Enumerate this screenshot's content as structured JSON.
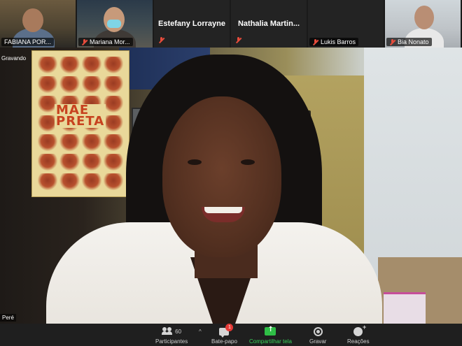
{
  "gallery": {
    "tiles": [
      {
        "name": "FABIANA POR...",
        "muted": false,
        "has_video": true
      },
      {
        "name": "Mariana Mor...",
        "muted": true,
        "has_video": true
      },
      {
        "name": "Estefany Lorrayne",
        "muted": true,
        "has_video": false
      },
      {
        "name": "Nathalia  Martin...",
        "muted": true,
        "has_video": false
      },
      {
        "name": "Lukis Barros",
        "muted": true,
        "has_video": false
      },
      {
        "name": "Bia Nonato",
        "muted": true,
        "has_video": true
      }
    ]
  },
  "main_video": {
    "recording_label": "Gravando",
    "speaker_name": "Peré",
    "poster_text": [
      "MÃE",
      "PRETA"
    ]
  },
  "toolbar": {
    "participants_label": "Participantes",
    "participants_count": "60",
    "chat_label": "Bate-papo",
    "chat_badge": "1",
    "share_label": "Compartilhar tela",
    "record_label": "Gravar",
    "reactions_label": "Reações",
    "accent_color": "#3ad25a"
  }
}
